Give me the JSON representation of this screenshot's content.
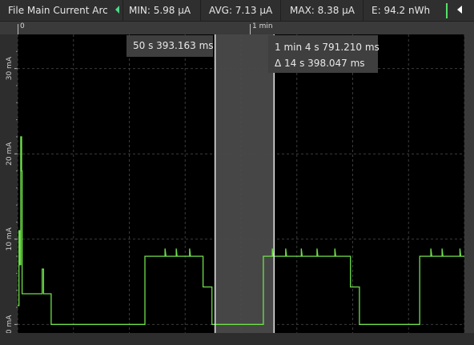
{
  "toolbar": {
    "title": "File Main Current Arc",
    "min": "MIN: 5.98 µA",
    "avg": "AVG: 7.13 µA",
    "max": "MAX: 8.38 µA",
    "energy": "E: 94.2 nWh"
  },
  "timeline": {
    "start_label": "0",
    "mid_label": "1 min"
  },
  "cursors": {
    "left_time": "50 s 393.163 ms",
    "right_time": "1 min 4 s 791.210 ms",
    "delta": "Δ 14 s 398.047 ms"
  },
  "colors": {
    "trace": "#6ee04a",
    "plot_bg": "#000000",
    "selection": "#4a4a4a"
  },
  "chart_data": {
    "type": "line",
    "ylabel": "",
    "y_tick_labels": [
      "0 mA",
      "10 mA",
      "20 mA",
      "30 mA"
    ],
    "ylim": [
      -1,
      34
    ],
    "xlim": [
      0,
      100
    ],
    "series": [
      {
        "values": [
          [
            0.0,
            2.2
          ],
          [
            0.3,
            2.2
          ],
          [
            0.3,
            11
          ],
          [
            0.5,
            11
          ],
          [
            0.5,
            7
          ],
          [
            0.7,
            7
          ],
          [
            0.7,
            22
          ],
          [
            0.9,
            22
          ],
          [
            0.9,
            18
          ],
          [
            1.0,
            18
          ],
          [
            1.0,
            3.6
          ],
          [
            5.5,
            3.6
          ],
          [
            5.5,
            6.5
          ],
          [
            5.8,
            6.5
          ],
          [
            5.8,
            3.6
          ],
          [
            7.5,
            3.6
          ],
          [
            7.5,
            0
          ],
          [
            28.5,
            0
          ],
          [
            28.5,
            8.0
          ],
          [
            33,
            8.0
          ],
          [
            33,
            8.9
          ],
          [
            33.2,
            8.0
          ],
          [
            35.5,
            8.0
          ],
          [
            35.5,
            8.9
          ],
          [
            35.7,
            8.0
          ],
          [
            38.5,
            8.0
          ],
          [
            38.5,
            8.9
          ],
          [
            38.7,
            8.0
          ],
          [
            41.5,
            8.0
          ],
          [
            41.5,
            4.4
          ],
          [
            43.5,
            4.4
          ],
          [
            43.5,
            0
          ],
          [
            55,
            0
          ],
          [
            55,
            8.0
          ],
          [
            57,
            8.0
          ],
          [
            57,
            8.9
          ],
          [
            57.2,
            8.0
          ],
          [
            60,
            8.0
          ],
          [
            60,
            8.9
          ],
          [
            60.2,
            8.0
          ],
          [
            63.5,
            8.0
          ],
          [
            63.5,
            8.9
          ],
          [
            63.7,
            8.0
          ],
          [
            67,
            8.0
          ],
          [
            67,
            8.9
          ],
          [
            67.2,
            8.0
          ],
          [
            71,
            8.0
          ],
          [
            71,
            8.9
          ],
          [
            71.2,
            8.0
          ],
          [
            74.5,
            8.0
          ],
          [
            74.5,
            4.4
          ],
          [
            76.5,
            4.4
          ],
          [
            76.5,
            0
          ],
          [
            90,
            0
          ],
          [
            90,
            8.0
          ],
          [
            92.5,
            8.0
          ],
          [
            92.5,
            8.9
          ],
          [
            92.7,
            8.0
          ],
          [
            95,
            8.0
          ],
          [
            95,
            8.9
          ],
          [
            95.2,
            8.0
          ],
          [
            99,
            8.0
          ],
          [
            99,
            8.9
          ],
          [
            99.2,
            8.0
          ],
          [
            100,
            8.0
          ]
        ]
      }
    ],
    "selection_x": [
      44.2,
      57.4
    ],
    "cursor_x": [
      44.2,
      57.4
    ],
    "grid": true
  }
}
